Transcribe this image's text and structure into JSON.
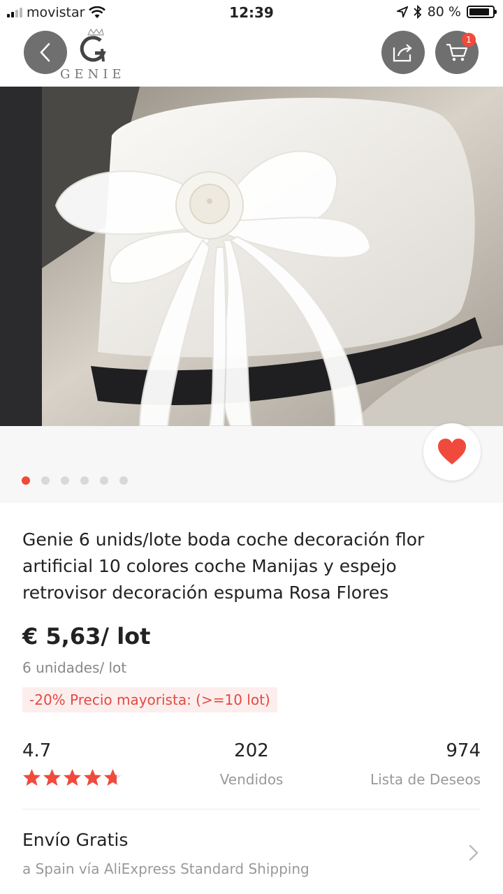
{
  "status_bar": {
    "carrier": "movistar",
    "time": "12:39",
    "battery": "80 %"
  },
  "header": {
    "brand": "GENIE",
    "cart_count": "1"
  },
  "product": {
    "title": "Genie 6 unids/lote boda coche decoración flor artificial 10 colores coche Manijas y espejo retrovisor decoración espuma Rosa Flores",
    "price": "€ 5,63/ lot",
    "unit": "6 unidades/ lot",
    "promo": "-20% Precio mayorista: (>=10 lot)",
    "image_count": 6,
    "active_image": 1
  },
  "stats": {
    "rating": "4.7",
    "rating_value": 4.7,
    "sold": "202",
    "sold_label": "Vendidos",
    "wishlist": "974",
    "wishlist_label": "Lista de Deseos"
  },
  "shipping": {
    "title": "Envío Gratis",
    "subtitle": "a Spain vía AliExpress Standard Shipping"
  },
  "colors": {
    "accent": "#f04a3c"
  }
}
